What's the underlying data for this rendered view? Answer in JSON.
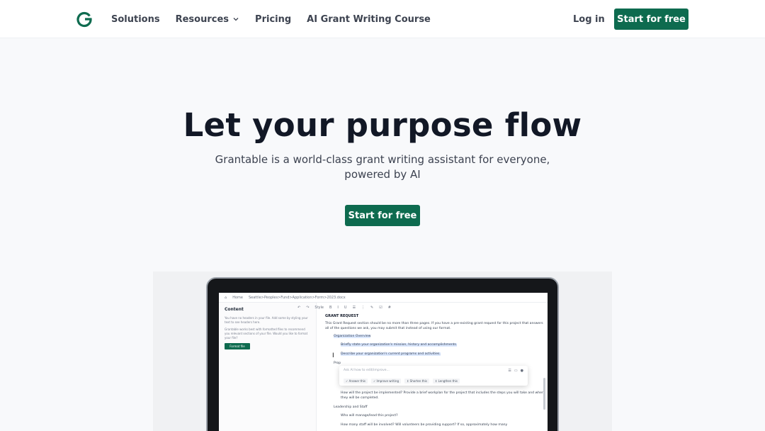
{
  "nav": {
    "links": [
      {
        "label": "Solutions"
      },
      {
        "label": "Resources"
      },
      {
        "label": "Pricing"
      },
      {
        "label": "AI Grant Writing Course"
      }
    ],
    "login": "Log in",
    "cta": "Start for free"
  },
  "hero": {
    "title": "Let your purpose flow",
    "subtitle": "Grantable is a world-class grant writing assistant for everyone, powered by AI",
    "cta": "Start for free"
  },
  "mockup": {
    "breadcrumb_home": "Home",
    "breadcrumb_path": "Seattle>Peoples>Fund>Application>Form>2023.docx",
    "content_head": "Content",
    "left_text_1": "You have no headers in your file. Add some by styling your text to see headers here.",
    "left_text_2": "Grantable works best with formatted files to recommend you relevant sections of your file. Would you like to format your file?",
    "format_button": "Format file",
    "toolbar": [
      "↶",
      "↷",
      "Style",
      "B",
      "I",
      "U",
      "☰",
      "⋮",
      "✎",
      "☑",
      "#"
    ],
    "doc": {
      "heading": "GRANT REQUEST",
      "intro": "This Grant Request section should be no more than three pages. If you have a pre-existing grant request for this project that answers all of the questions we ask, you may submit that instead of using our format.",
      "org_overview": "Organization Overview",
      "q1": "Briefly state your organization's mission, history and accomplishments.",
      "q2": "Describe your organization's current programs and activities.",
      "prop": "Prop",
      "q3": "What are the goals of the project? How does the project benefit the communities you work with?",
      "q4": "How will the project be implemented? Provide a brief workplan for the project that includes the steps you will take and when they will be completed.",
      "leadership": "Leadership and Staff",
      "q5": "Who will manage/lead this project?",
      "q6": "How many staff will be involved? Will volunteers be providing support? If so, approximately how many"
    },
    "ai": {
      "placeholder": "Ask AI how to edit/improve...",
      "actions": [
        "✓ Answer this",
        "✓ Improve writing",
        "↕ Shorten this",
        "↕ Lengthen this"
      ]
    }
  },
  "colors": {
    "brand_green": "#0e6b4f",
    "title": "#121826"
  }
}
